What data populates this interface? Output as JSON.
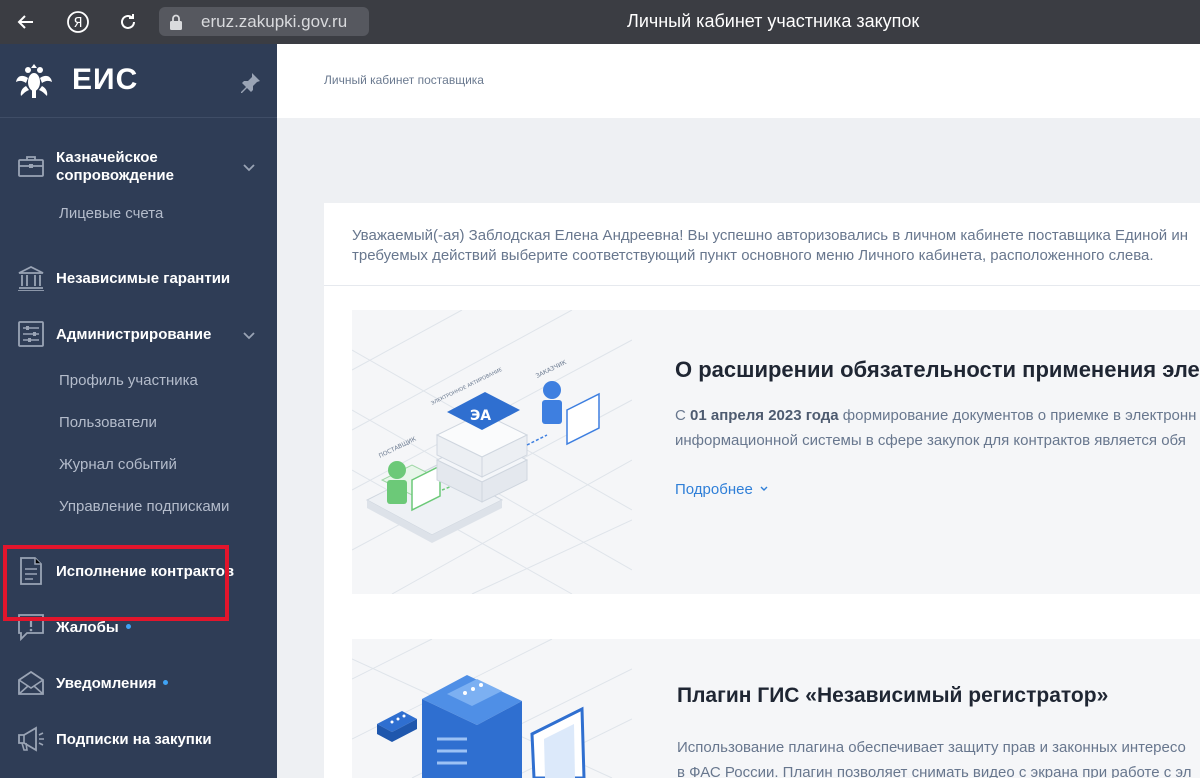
{
  "browser": {
    "url": "eruz.zakupki.gov.ru",
    "page_title": "Личный кабинет участника закупок"
  },
  "sidebar": {
    "logo_text": "ЕИС",
    "items": [
      {
        "label_line1": "Казначейское",
        "label_line2": "сопровождение",
        "icon": "briefcase-icon",
        "sub": [
          "Лицевые счета"
        ]
      },
      {
        "label": "Независимые гарантии",
        "icon": "bank-icon"
      },
      {
        "label": "Администрирование",
        "icon": "settings-sliders-icon",
        "sub": [
          "Профиль участника",
          "Пользователи",
          "Журнал событий",
          "Управление подписками"
        ]
      },
      {
        "label": "Исполнение контрактов",
        "icon": "document-icon"
      },
      {
        "label": "Жалобы",
        "icon": "complaint-icon",
        "has_dot": true
      },
      {
        "label": "Уведомления",
        "icon": "envelope-icon",
        "has_dot": true
      },
      {
        "label": "Подписки на закупки",
        "icon": "megaphone-icon"
      }
    ]
  },
  "header": {
    "breadcrumb": "Личный кабинет поставщика"
  },
  "main": {
    "greeting_line1": "Уважаемый(-ая) Заблодская Елена Андреевна! Вы успешно авторизовались в личном кабинете поставщика Единой ин",
    "greeting_line2": "требуемых действий выберите соответствующий пункт основного меню Личного кабинета, расположенного слева.",
    "news": [
      {
        "title": "О расширении обязательности применения электр",
        "text_line1_prefix": "С ",
        "text_line1_bold": "01 апреля 2023 года",
        "text_line1_suffix": " формирование документов о приемке в электронн",
        "text_line2": "информационной системы в сфере закупок для контрактов является обя",
        "more": "Подробнее",
        "illustration_labels": {
          "supplier": "ПОСТАВЩИК",
          "customer": "ЗАКАЗЧИК",
          "edo": "ЭЛЕКТРОННОЕ АКТИРОВАНИЕ",
          "badge": "ЭА"
        }
      },
      {
        "title": "Плагин ГИС «Независимый регистратор»",
        "text_line1": "Использование плагина обеспечивает защиту прав и законных интересо",
        "text_line2": "в ФАС России. Плагин позволяет снимать видео с экрана при работе с эл"
      }
    ]
  },
  "colors": {
    "sidebar_bg": "#2f3d56",
    "highlight": "#e3152c",
    "link": "#2f7fd8",
    "dot": "#3fa3f5"
  }
}
